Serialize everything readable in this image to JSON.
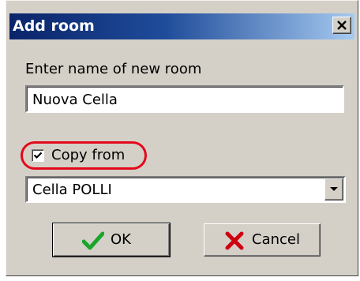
{
  "window": {
    "title": "Add room",
    "close_icon": "close-icon"
  },
  "form": {
    "name_label": "Enter name of new room",
    "name_value": "Nuova Cella",
    "copy_checked": true,
    "copy_label": "Copy from",
    "copy_source_value": "Cella POLLI",
    "highlight_color": "#e4081c"
  },
  "buttons": {
    "ok_label": "OK",
    "ok_icon": "checkmark-icon",
    "cancel_label": "Cancel",
    "cancel_icon": "x-icon"
  },
  "colors": {
    "titlebar_start": "#0a246a",
    "titlebar_end": "#a6caf0",
    "dialog_bg": "#d4d0c8",
    "ok_icon_color": "#1aa52b",
    "cancel_icon_color": "#d00010"
  }
}
